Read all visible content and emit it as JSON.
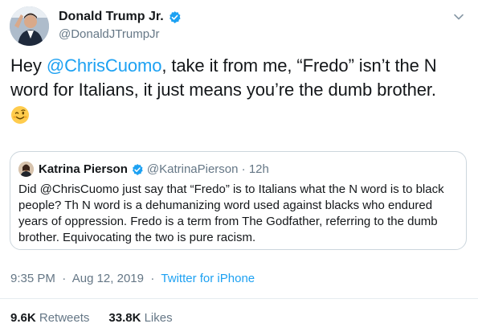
{
  "author": {
    "display_name": "Donald Trump Jr.",
    "handle": "@DonaldJTrumpJr",
    "verified": true
  },
  "tweet": {
    "text_pre": "Hey ",
    "mention": "@ChrisCuomo",
    "text_post": ", take it from me, “Fredo” isn’t the N word for Italians, it just means you’re the dumb brother.",
    "emoji": "winking-face"
  },
  "quoted_tweet": {
    "display_name": "Katrina Pierson",
    "handle": "@KatrinaPierson",
    "age": "12h",
    "verified": true,
    "text": "Did @ChrisCuomo  just say that “Fredo” is to Italians what the N word is to black people? Th N word is a dehumanizing word used against blacks who endured years of oppression. Fredo is a term from The Godfather, referring to the dumb brother. Equivocating the two is pure racism."
  },
  "meta": {
    "time": "9:35 PM",
    "date": "Aug 12, 2019",
    "source": "Twitter for iPhone"
  },
  "stats": {
    "retweets_count": "9.6K",
    "retweets_label": "Retweets",
    "likes_count": "33.8K",
    "likes_label": "Likes"
  },
  "colors": {
    "link": "#1da1f2",
    "secondary_text": "#657786",
    "border": "#ccd6dd"
  }
}
